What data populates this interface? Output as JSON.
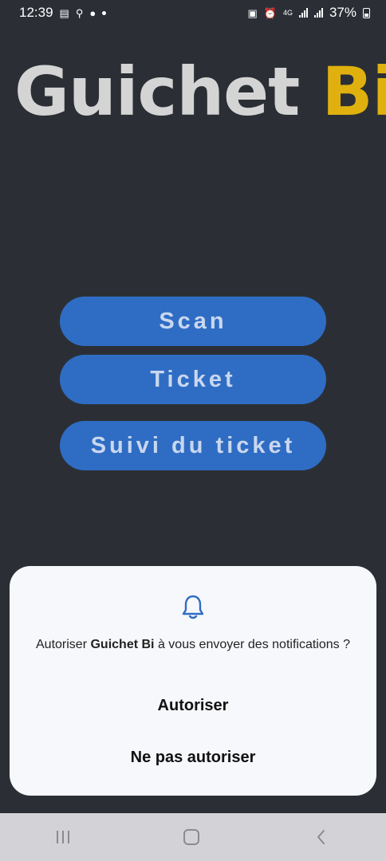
{
  "status_bar": {
    "time": "12:39",
    "network": "4G",
    "battery": "37%",
    "left_icons": [
      "gallery-icon",
      "usb-icon",
      "chat-icon",
      "dot-icon"
    ],
    "right_icons": [
      "battery-saver-icon",
      "alarm-icon",
      "network-4g-icon",
      "signal-icon",
      "signal-icon",
      "battery-icon"
    ]
  },
  "logo": {
    "part1": "Guichet",
    "part2": "Bi"
  },
  "buttons": {
    "scan": "Scan",
    "ticket": "Ticket",
    "suivi": "Suivi du ticket"
  },
  "dialog": {
    "icon": "bell-icon",
    "message_prefix": "Autoriser",
    "app_name": "Guichet Bi",
    "message_suffix": "à vous envoyer des notifications ?",
    "allow": "Autoriser",
    "deny": "Ne pas autoriser"
  },
  "navigation": {
    "icons": [
      "recent-apps-icon",
      "home-icon",
      "back-icon"
    ]
  },
  "colors": {
    "background": "#2b2f35",
    "button": "#2f6dc4",
    "logo_white": "#d4d4d4",
    "logo_yellow": "#e0b10e",
    "dialog": "#f7f8fc",
    "accent": "#2f6dc4"
  }
}
